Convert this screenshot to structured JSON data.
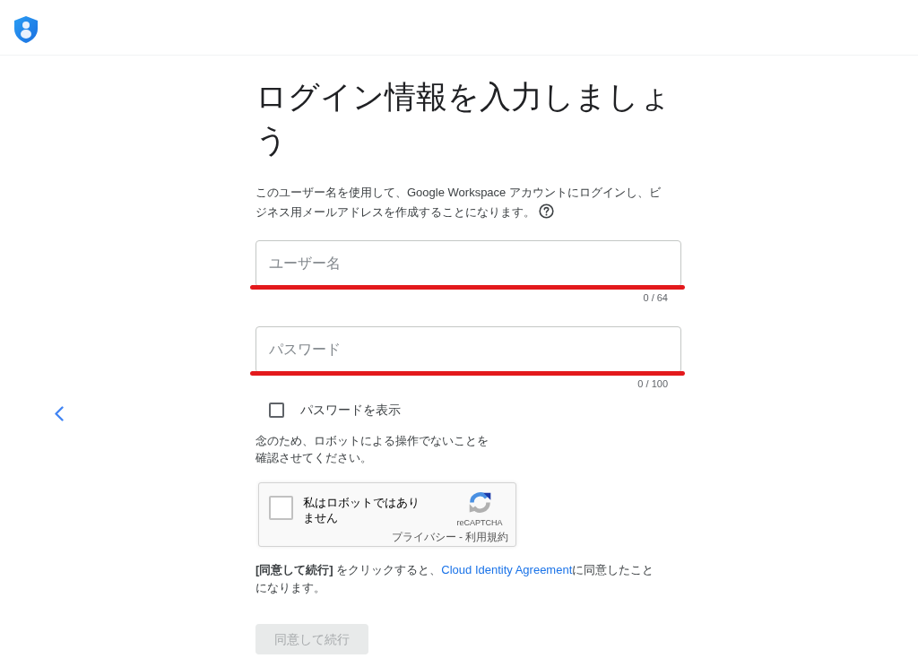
{
  "title": "ログイン情報を入力しましょう",
  "description": "このユーザー名を使用して、Google Workspace アカウントにログインし、ビジネス用メールアドレスを作成することになります。",
  "fields": [
    {
      "placeholder": "ユーザー名",
      "counter": "0 / 64",
      "highlighted": true
    },
    {
      "placeholder": "パスワード",
      "counter": "0 / 100",
      "highlighted": true
    }
  ],
  "show_password": {
    "label": "パスワードを表示",
    "checked": false
  },
  "captcha": {
    "prompt": "念のため、ロボットによる操作でないことを確認させてください。",
    "label": "私はロボットではありません",
    "checked": false,
    "brand": "reCAPTCHA",
    "links": [
      "プライバシー",
      "利用規約"
    ],
    "link_separator": "-"
  },
  "agreement": [
    {
      "kind": "text",
      "text": "**[同意して続行]** をクリックすると、"
    },
    {
      "kind": "link",
      "text": "Cloud Identity Agreement"
    },
    {
      "kind": "text",
      "text": "に同意したことになります。"
    }
  ],
  "continue_button": {
    "label": "同意して続行",
    "disabled": true
  }
}
